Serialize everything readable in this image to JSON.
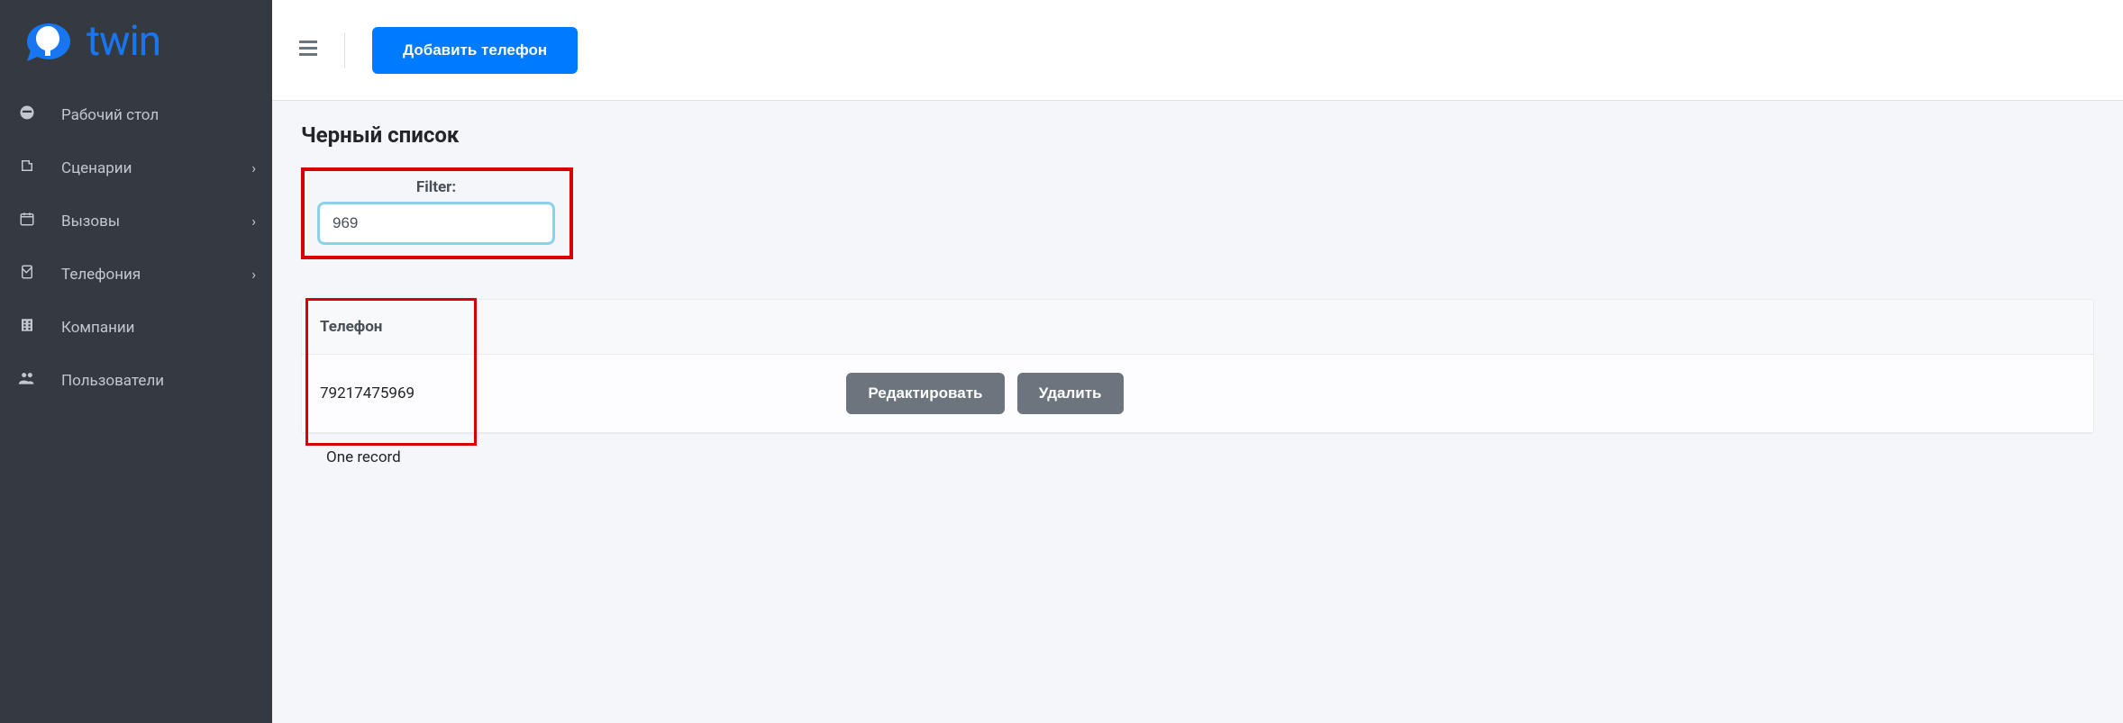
{
  "brand": {
    "name": "twin"
  },
  "sidebar": {
    "items": [
      {
        "label": "Рабочий стол",
        "icon": "dashboard-icon",
        "expandable": false
      },
      {
        "label": "Сценарии",
        "icon": "document-icon",
        "expandable": true
      },
      {
        "label": "Вызовы",
        "icon": "calendar-icon",
        "expandable": true
      },
      {
        "label": "Телефония",
        "icon": "phone-icon",
        "expandable": true
      },
      {
        "label": "Компании",
        "icon": "building-icon",
        "expandable": false
      },
      {
        "label": "Пользователи",
        "icon": "users-icon",
        "expandable": false
      }
    ]
  },
  "topbar": {
    "add_button_label": "Добавить телефон"
  },
  "page": {
    "title": "Черный список",
    "filter": {
      "label": "Filter:",
      "value": "969"
    },
    "table": {
      "columns": [
        "Телефон",
        ""
      ],
      "rows": [
        {
          "phone": "79217475969"
        }
      ],
      "edit_label": "Редактировать",
      "delete_label": "Удалить",
      "record_count_label": "One record"
    }
  }
}
